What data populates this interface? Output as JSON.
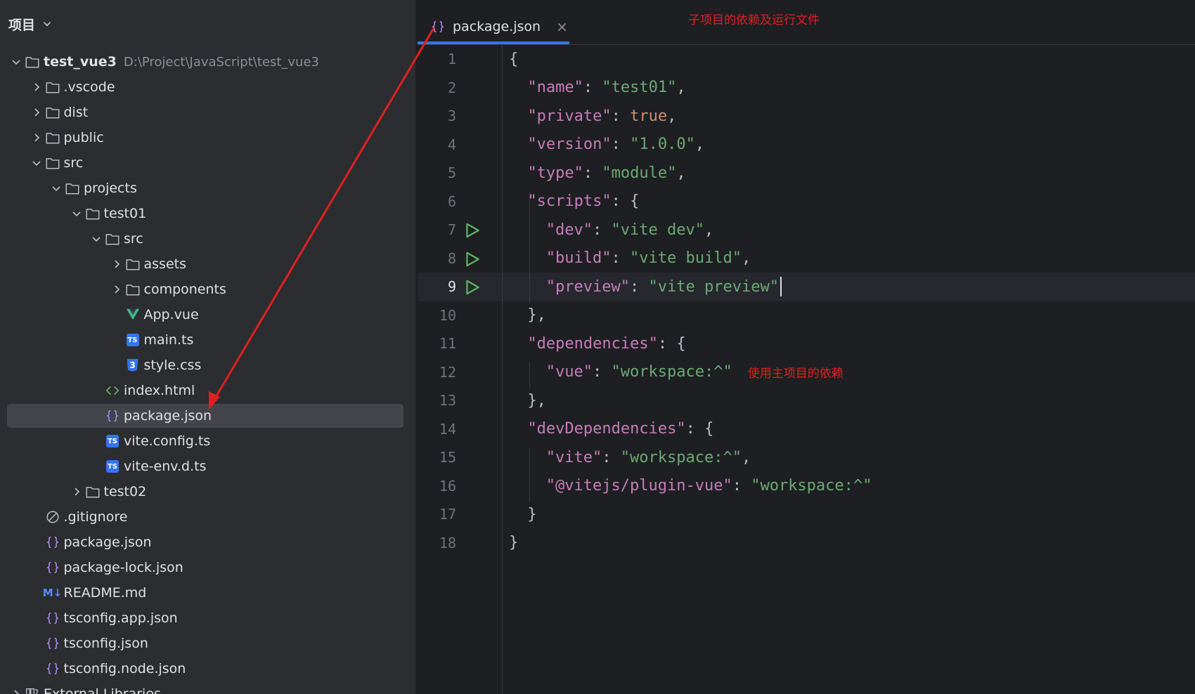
{
  "panel": {
    "title": "项目"
  },
  "tree": {
    "root": {
      "name": "test_vue3",
      "path": "D:\\Project\\JavaScript\\test_vue3"
    },
    "items": [
      {
        "label": ".vscode"
      },
      {
        "label": "dist"
      },
      {
        "label": "public"
      },
      {
        "label": "src"
      },
      {
        "label": "projects"
      },
      {
        "label": "test01"
      },
      {
        "label": "src"
      },
      {
        "label": "assets"
      },
      {
        "label": "components"
      },
      {
        "label": "App.vue"
      },
      {
        "label": "main.ts"
      },
      {
        "label": "style.css"
      },
      {
        "label": "index.html"
      },
      {
        "label": "package.json"
      },
      {
        "label": "vite.config.ts"
      },
      {
        "label": "vite-env.d.ts"
      },
      {
        "label": "test02"
      },
      {
        "label": ".gitignore"
      },
      {
        "label": "package.json"
      },
      {
        "label": "package-lock.json"
      },
      {
        "label": "README.md"
      },
      {
        "label": "tsconfig.app.json"
      },
      {
        "label": "tsconfig.json"
      },
      {
        "label": "tsconfig.node.json"
      },
      {
        "label": "External Libraries"
      }
    ]
  },
  "editor": {
    "tab": {
      "label": "package.json",
      "close": "×"
    },
    "annotations": {
      "tab_note": "子项目的依赖及运行文件",
      "line12_note": "使用主项目的依赖"
    },
    "lines": [
      {
        "num": "1",
        "parts": [
          "{",
          "",
          "",
          ""
        ]
      },
      {
        "num": "2",
        "parts": [
          "\"name\"",
          ": ",
          "\"test01\"",
          ","
        ]
      },
      {
        "num": "3",
        "parts": [
          "\"private\"",
          ": ",
          "true",
          ","
        ]
      },
      {
        "num": "4",
        "parts": [
          "\"version\"",
          ": ",
          "\"1.0.0\"",
          ","
        ]
      },
      {
        "num": "5",
        "parts": [
          "\"type\"",
          ": ",
          "\"module\"",
          ","
        ]
      },
      {
        "num": "6",
        "parts": [
          "\"scripts\"",
          ": ",
          "{",
          ""
        ]
      },
      {
        "num": "7",
        "parts": [
          "\"dev\"",
          ": ",
          "\"vite dev\"",
          ","
        ]
      },
      {
        "num": "8",
        "parts": [
          "\"build\"",
          ": ",
          "\"vite build\"",
          ","
        ]
      },
      {
        "num": "9",
        "parts": [
          "\"preview\"",
          ": ",
          "\"vite preview\"",
          ""
        ]
      },
      {
        "num": "10",
        "parts": [
          "},",
          "",
          "",
          ""
        ]
      },
      {
        "num": "11",
        "parts": [
          "\"dependencies\"",
          ": ",
          "{",
          ""
        ]
      },
      {
        "num": "12",
        "parts": [
          "\"vue\"",
          ": ",
          "\"workspace:^\"",
          ""
        ]
      },
      {
        "num": "13",
        "parts": [
          "},",
          "",
          "",
          ""
        ]
      },
      {
        "num": "14",
        "parts": [
          "\"devDependencies\"",
          ": ",
          "{",
          ""
        ]
      },
      {
        "num": "15",
        "parts": [
          "\"vite\"",
          ": ",
          "\"workspace:^\"",
          ","
        ]
      },
      {
        "num": "16",
        "parts": [
          "\"@vitejs/plugin-vue\"",
          ": ",
          "\"workspace:^\"",
          ""
        ]
      },
      {
        "num": "17",
        "parts": [
          "}",
          "",
          "",
          ""
        ]
      },
      {
        "num": "18",
        "parts": [
          "}",
          "",
          "",
          ""
        ]
      }
    ]
  },
  "colors": {
    "accent": "#3574f0",
    "annotation": "#e02020",
    "run_icon": "#5fb865",
    "key": "#c77dbb",
    "string": "#6aab73",
    "keyword": "#cf8e6d"
  }
}
